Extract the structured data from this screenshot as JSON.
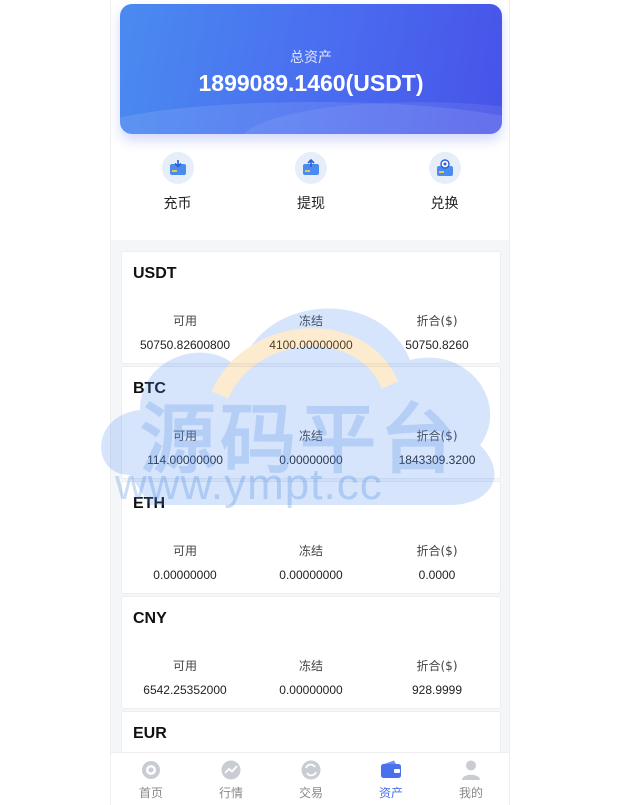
{
  "summary": {
    "label": "总资产",
    "value": "1899089.1460(USDT)"
  },
  "actions": [
    {
      "label": "充币",
      "icon": "deposit-icon"
    },
    {
      "label": "提现",
      "icon": "withdraw-icon"
    },
    {
      "label": "兑换",
      "icon": "exchange-icon"
    }
  ],
  "columns": {
    "available": "可用",
    "frozen": "冻结",
    "converted": "折合($)"
  },
  "coins": [
    {
      "name": "USDT",
      "available": "50750.82600800",
      "frozen": "4100.00000000",
      "converted": "50750.8260"
    },
    {
      "name": "BTC",
      "available": "114.00000000",
      "frozen": "0.00000000",
      "converted": "1843309.3200"
    },
    {
      "name": "ETH",
      "available": "0.00000000",
      "frozen": "0.00000000",
      "converted": "0.0000"
    },
    {
      "name": "CNY",
      "available": "6542.25352000",
      "frozen": "0.00000000",
      "converted": "928.9999"
    },
    {
      "name": "EUR"
    }
  ],
  "watermark": {
    "title": "源码平台",
    "url": "www.ympt.cc"
  },
  "tabs": [
    {
      "label": "首页",
      "icon": "home-icon"
    },
    {
      "label": "行情",
      "icon": "market-icon"
    },
    {
      "label": "交易",
      "icon": "trade-icon"
    },
    {
      "label": "资产",
      "icon": "wallet-icon",
      "active": true
    },
    {
      "label": "我的",
      "icon": "user-icon"
    }
  ],
  "colors": {
    "accent": "#4a70ee",
    "card_start": "#4a8bf0",
    "card_end": "#4753e8"
  }
}
